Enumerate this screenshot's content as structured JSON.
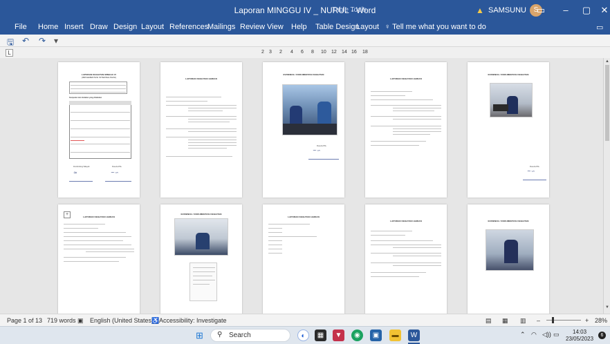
{
  "window": {
    "title": "Laporan MINGGU IV _ NURUL  -  Word",
    "contextual_tab": "Table Tools",
    "user": "SAMSUNU",
    "user_initial": "S",
    "controls": [
      "▭",
      "–",
      "▢",
      "✕"
    ]
  },
  "ribbon": {
    "tabs": [
      "File",
      "Home",
      "Insert",
      "Draw",
      "Design",
      "Layout",
      "References",
      "Mailings",
      "Review",
      "View",
      "Help",
      "Table Design",
      "Layout"
    ],
    "tell_me": "Tell me what you want to do"
  },
  "qat": {
    "save": "🖫",
    "undo": "↶",
    "redo": "↷",
    "customize": "▾"
  },
  "ruler": {
    "corner": "L",
    "zoom_ticks": [
      "2",
      "3",
      "2",
      "4",
      "6",
      "8",
      "10",
      "12",
      "14",
      "16",
      "18"
    ]
  },
  "pages": {
    "p1": {
      "heading": "LAPORAN KEGIATAN MINGGU IV",
      "sub": "(IMPLEMENTASI INTERNALISASI)",
      "section": "Kumpulan dan tindakan yang dilakukan",
      "signer_left": "Pembimbing Wilayah",
      "signer_right": "Peserta PKL"
    },
    "p2": {
      "heading": "LAPORAN KEGIATAN HARIAN"
    },
    "p3": {
      "heading": "EVIDENCE / DOKUMENTASI KEGIATAN",
      "signer": "Peserta PKL"
    },
    "p4": {
      "heading": "LAPORAN KEGIATAN HARIAN"
    },
    "p5": {
      "heading": "EVIDENCE / DOKUMENTASI KEGIATAN",
      "signer": "Peserta PKL"
    },
    "p6": {
      "heading": "LAPORAN KEGIATAN HARIAN"
    },
    "p7": {
      "heading": "EVIDENCE / DOKUMENTASI KEGIATAN"
    },
    "p8": {
      "heading": "LAPORAN KEGIATAN HARIAN"
    },
    "p9": {
      "heading": "LAPORAN KEGIATAN HARIAN"
    },
    "p10": {
      "heading": "EVIDENCE / DOKUMENTASI KEGIATAN"
    }
  },
  "statusbar": {
    "page": "Page 1 of 13",
    "words": "719 words",
    "language": "English (United States)",
    "accessibility": "Accessibility: Investigate",
    "zoom": "28%"
  },
  "taskbar": {
    "search": "Search",
    "time": "14:03",
    "date": "23/05/2023",
    "notifications": "6"
  },
  "colors": {
    "word_blue": "#2b579a",
    "statusbar_bg": "#f3f3f3",
    "taskbar_bg": "#dfe6ee"
  }
}
